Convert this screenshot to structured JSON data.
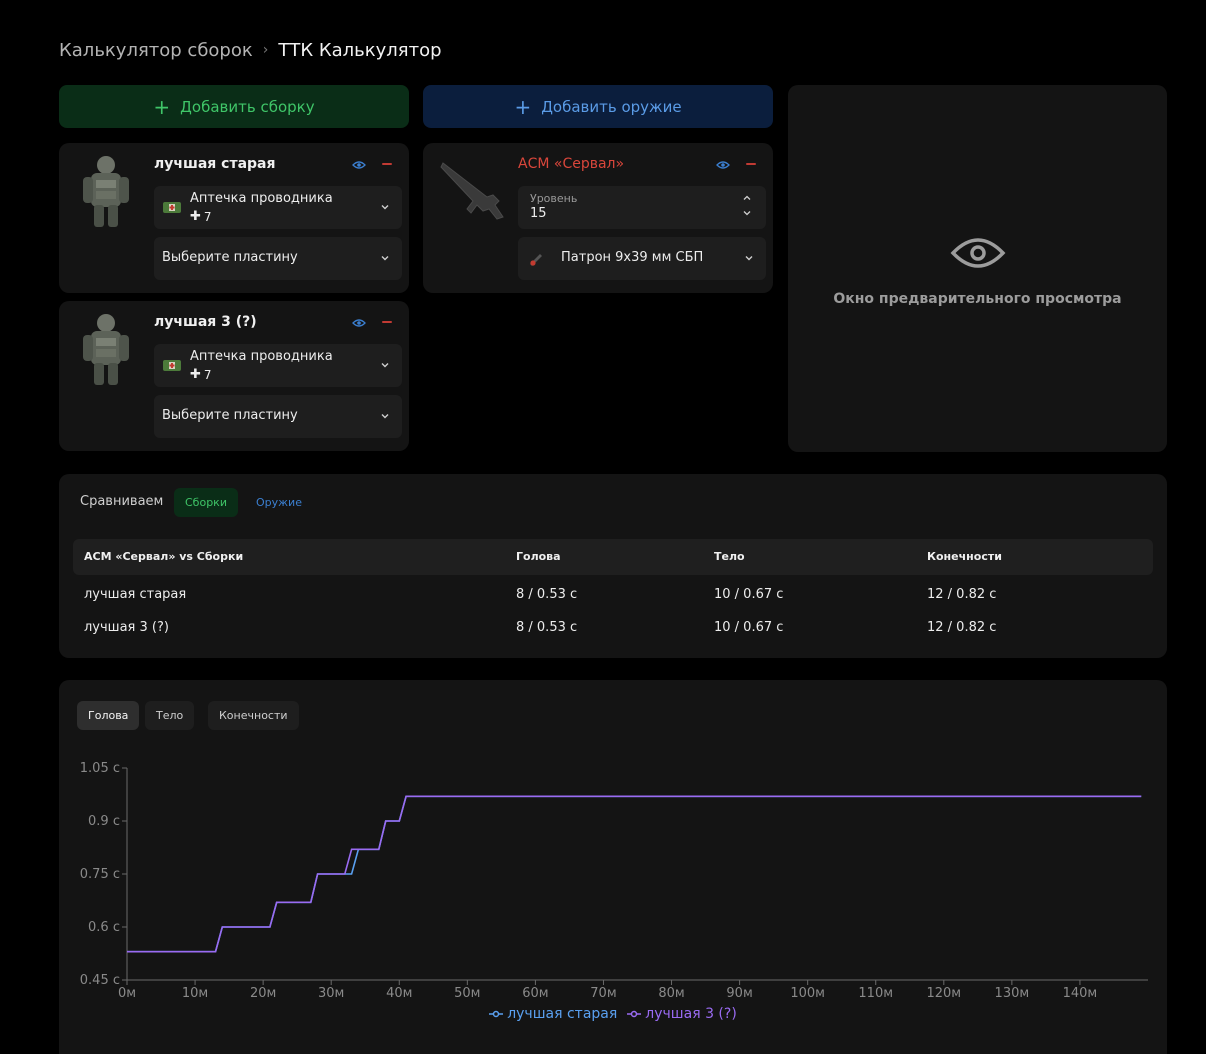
{
  "breadcrumb": {
    "root": "Калькулятор сборок",
    "current": "ТТК Калькулятор"
  },
  "actions": {
    "add_build": "Добавить сборку",
    "add_weapon": "Добавить оружие"
  },
  "builds": [
    {
      "name": "лучшая старая",
      "medkit": "Аптечка проводника",
      "medkit_count": "7",
      "plate": "Выберите пластину"
    },
    {
      "name": "лучшая 3 (?)",
      "medkit": "Аптечка проводника",
      "medkit_count": "7",
      "plate": "Выберите пластину"
    }
  ],
  "weapon": {
    "name": "АСМ «Сервал»",
    "level_label": "Уровень",
    "level_value": "15",
    "ammo": "Патрон 9x39 мм СБП"
  },
  "preview": {
    "text": "Окно предварительного просмотра"
  },
  "compare": {
    "label": "Сравниваем",
    "tab_builds": "Сборки",
    "tab_weapons": "Оружие",
    "headers": [
      "АСМ «Сервал» vs Сборки",
      "Голова",
      "Тело",
      "Конечности"
    ],
    "rows": [
      [
        "лучшая старая",
        "8 / 0.53 с",
        "10 / 0.67 с",
        "12 / 0.82 с"
      ],
      [
        "лучшая 3 (?)",
        "8 / 0.53 с",
        "10 / 0.67 с",
        "12 / 0.82 с"
      ]
    ]
  },
  "chart_tabs": [
    "Голова",
    "Тело",
    "Конечности"
  ],
  "colors": {
    "build_green": "#3fc568",
    "weapon_blue": "#5a9be6",
    "danger_red": "#d9463b",
    "series_1": "#5aa0f0",
    "series_2": "#9a6bf2"
  },
  "chart_data": {
    "type": "line",
    "x_ticks": [
      "0м",
      "10м",
      "20м",
      "30м",
      "40м",
      "50м",
      "60м",
      "70м",
      "80м",
      "90м",
      "100м",
      "110м",
      "120м",
      "130м",
      "140м"
    ],
    "y_ticks": [
      "0.45 с",
      "0.6 с",
      "0.75 с",
      "0.9 с",
      "1.05 с"
    ],
    "xlim": [
      0,
      150
    ],
    "ylim": [
      0.45,
      1.05
    ],
    "series": [
      {
        "name": "лучшая старая",
        "points": [
          [
            0,
            0.53
          ],
          [
            13,
            0.53
          ],
          [
            14,
            0.6
          ],
          [
            21,
            0.6
          ],
          [
            22,
            0.67
          ],
          [
            27,
            0.67
          ],
          [
            28,
            0.75
          ],
          [
            33,
            0.75
          ],
          [
            34,
            0.82
          ],
          [
            37,
            0.82
          ],
          [
            38,
            0.9
          ],
          [
            40,
            0.9
          ],
          [
            41,
            0.97
          ],
          [
            149,
            0.97
          ]
        ]
      },
      {
        "name": "лучшая 3 (?)",
        "points": [
          [
            0,
            0.53
          ],
          [
            13,
            0.53
          ],
          [
            14,
            0.6
          ],
          [
            21,
            0.6
          ],
          [
            22,
            0.67
          ],
          [
            27,
            0.67
          ],
          [
            28,
            0.75
          ],
          [
            32,
            0.75
          ],
          [
            33,
            0.82
          ],
          [
            37,
            0.82
          ],
          [
            38,
            0.9
          ],
          [
            40,
            0.9
          ],
          [
            41,
            0.97
          ],
          [
            149,
            0.97
          ]
        ]
      }
    ]
  }
}
